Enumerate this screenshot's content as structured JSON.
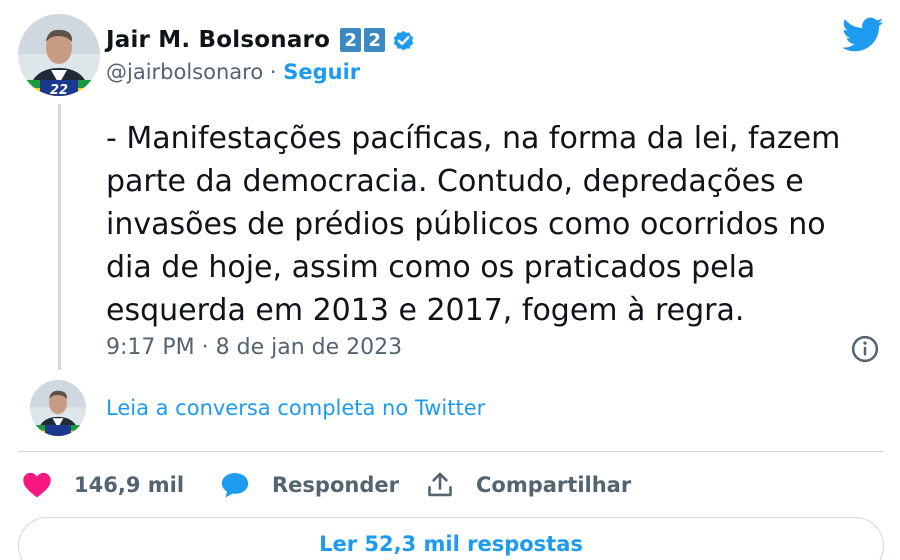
{
  "author": {
    "name": "Jair M. Bolsonaro",
    "badge_digits": [
      "2",
      "2"
    ],
    "handle": "@jairbolsonaro",
    "separator": "·",
    "follow_label": "Seguir"
  },
  "tweet": {
    "text": "- Manifestações pacíficas, na forma da lei, fazem parte da democracia. Contudo, depredações e invasões de prédios públicos como ocorridos no dia de hoje, assim como os praticados pela esquerda em 2013 e 2017, fogem à regra.",
    "timestamp": "9:17 PM · 8 de jan de 2023"
  },
  "thread": {
    "read_more_label": "Leia a conversa completa no Twitter"
  },
  "actions": {
    "likes_label": "146,9 mil",
    "reply_label": "Responder",
    "share_label": "Compartilhar"
  },
  "footer": {
    "read_replies_label": "Ler 52,3 mil respostas"
  },
  "icons": {
    "brand": "twitter-bird-icon",
    "verified": "verified-badge-icon",
    "info": "info-icon",
    "like": "heart-icon",
    "reply": "speech-bubble-icon",
    "share": "share-upload-icon"
  },
  "colors": {
    "brand_blue": "#1d9bf0",
    "like_pink": "#f91880",
    "badge_blue": "#3b88c3",
    "secondary_text": "#536471",
    "primary_text": "#0f1419",
    "border": "#cfd9de"
  }
}
